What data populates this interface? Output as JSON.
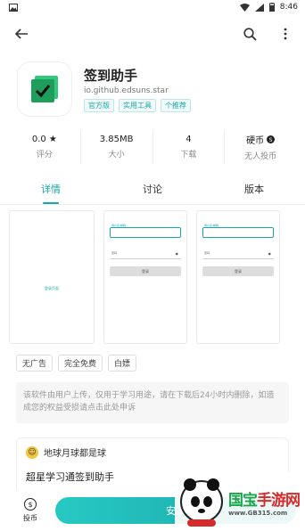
{
  "status_bar": {
    "time": "8:46"
  },
  "app": {
    "name": "签到助手",
    "package": "io.github.edsuns.star",
    "tags": [
      "官方版",
      "实用工具",
      "个推荐"
    ]
  },
  "stats": [
    {
      "value": "0.0 ★",
      "label": "评分"
    },
    {
      "value": "3.85MB",
      "label": "大小"
    },
    {
      "value": "4",
      "label": "下载"
    },
    {
      "value": "硬币",
      "label": "无人投币"
    }
  ],
  "tabs": [
    {
      "label": "详情",
      "active": true
    },
    {
      "label": "讨论",
      "active": false
    },
    {
      "label": "版本",
      "active": false
    }
  ],
  "screenshots": {
    "first_center_text": "登录页面",
    "field_label": "用户名/邮箱",
    "password_label": "密码",
    "button_label": "登录"
  },
  "features": [
    "无广告",
    "完全免费",
    "白嫖"
  ],
  "notice": "该软件由用户上传，仅用于学习用途，请在下载后24小时内删除，如造成您的权益受损请点击此处申诉",
  "comment": {
    "user": "地球月球都是球",
    "text": "超星学习通签到助手"
  },
  "bottom": {
    "coin_label": "投币",
    "install_label": "安装"
  },
  "watermark": {
    "brand_green": "国宝",
    "brand_red": "手游网",
    "url": "www.GB315.com"
  },
  "colors": {
    "accent": "#19a6a9"
  }
}
